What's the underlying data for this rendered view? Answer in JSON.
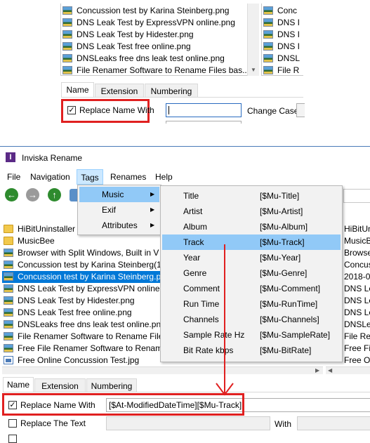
{
  "top_panel": {
    "files_left": [
      {
        "name": "Concussion test by Karina Steinberg.png",
        "type": "png"
      },
      {
        "name": "DNS Leak Test by ExpressVPN online.png",
        "type": "png"
      },
      {
        "name": "DNS Leak Test by Hidester.png",
        "type": "png"
      },
      {
        "name": "DNS Leak Test free online.png",
        "type": "png"
      },
      {
        "name": "DNSLeaks free dns leak test online.png",
        "type": "png"
      },
      {
        "name": "File Renamer Software to Rename Files bas...",
        "type": "png"
      }
    ],
    "files_right": [
      "Conc",
      "DNS I",
      "DNS I",
      "DNS I",
      "DNSL",
      "File R"
    ],
    "tabs": [
      "Name",
      "Extension",
      "Numbering"
    ],
    "replace_name_label": "Replace Name With",
    "change_case_label": "Change Case"
  },
  "window": {
    "title": "Inviska Rename",
    "menubar": [
      "File",
      "Navigation",
      "Tags",
      "Renames",
      "Help"
    ],
    "files_left": [
      {
        "name": "HiBitUninstaller",
        "type": "folder"
      },
      {
        "name": "MusicBee",
        "type": "folder"
      },
      {
        "name": "Browser with Split Windows, Built in V",
        "type": "png"
      },
      {
        "name": "Concussion test by Karina Steinberg(1",
        "type": "png"
      },
      {
        "name": "Concussion test by Karina Steinberg.p",
        "type": "png"
      },
      {
        "name": "DNS Leak Test by ExpressVPN online.p",
        "type": "png"
      },
      {
        "name": "DNS Leak Test by Hidester.png",
        "type": "png"
      },
      {
        "name": "DNS Leak Test free online.png",
        "type": "png"
      },
      {
        "name": "DNSLeaks free dns leak test online.png",
        "type": "png"
      },
      {
        "name": "File Renamer Software to Rename File",
        "type": "png"
      },
      {
        "name": "Free File Renamer Software to Rename",
        "type": "png"
      },
      {
        "name": "Free Online Concussion Test.jpg",
        "type": "jpg"
      }
    ],
    "files_right": [
      "HiBitUn",
      "MusicB",
      "Browse",
      "Concus",
      "2018-0",
      "DNS Le",
      "DNS Le",
      "DNS Le",
      "DNSLea",
      "File Re",
      "Free Fil",
      "Free O"
    ],
    "tags_menu": [
      {
        "label": "Music"
      },
      {
        "label": "Exif"
      },
      {
        "label": "Attributes"
      }
    ],
    "music_submenu": [
      {
        "name": "Title",
        "tag": "[$Mu-Title]"
      },
      {
        "name": "Artist",
        "tag": "[$Mu-Artist]"
      },
      {
        "name": "Album",
        "tag": "[$Mu-Album]"
      },
      {
        "name": "Track",
        "tag": "[$Mu-Track]"
      },
      {
        "name": "Year",
        "tag": "[$Mu-Year]"
      },
      {
        "name": "Genre",
        "tag": "[$Mu-Genre]"
      },
      {
        "name": "Comment",
        "tag": "[$Mu-Comment]"
      },
      {
        "name": "Run Time",
        "tag": "[$Mu-RunTime]"
      },
      {
        "name": "Channels",
        "tag": "[$Mu-Channels]"
      },
      {
        "name": "Sample Rate Hz",
        "tag": "[$Mu-SampleRate]"
      },
      {
        "name": "Bit Rate kbps",
        "tag": "[$Mu-BitRate]"
      }
    ],
    "tabs": [
      "Name",
      "Extension",
      "Numbering"
    ],
    "replace_name_label": "Replace Name With",
    "replace_name_value": "[$At-ModifiedDateTime][$Mu-Track]",
    "replace_text_label": "Replace The Text",
    "with_label": "With"
  },
  "colors": {
    "selection": "#0078d7",
    "menu_highlight": "#91c9f7",
    "annotation_red": "#e02020",
    "title_icon": "#5b2a86"
  }
}
